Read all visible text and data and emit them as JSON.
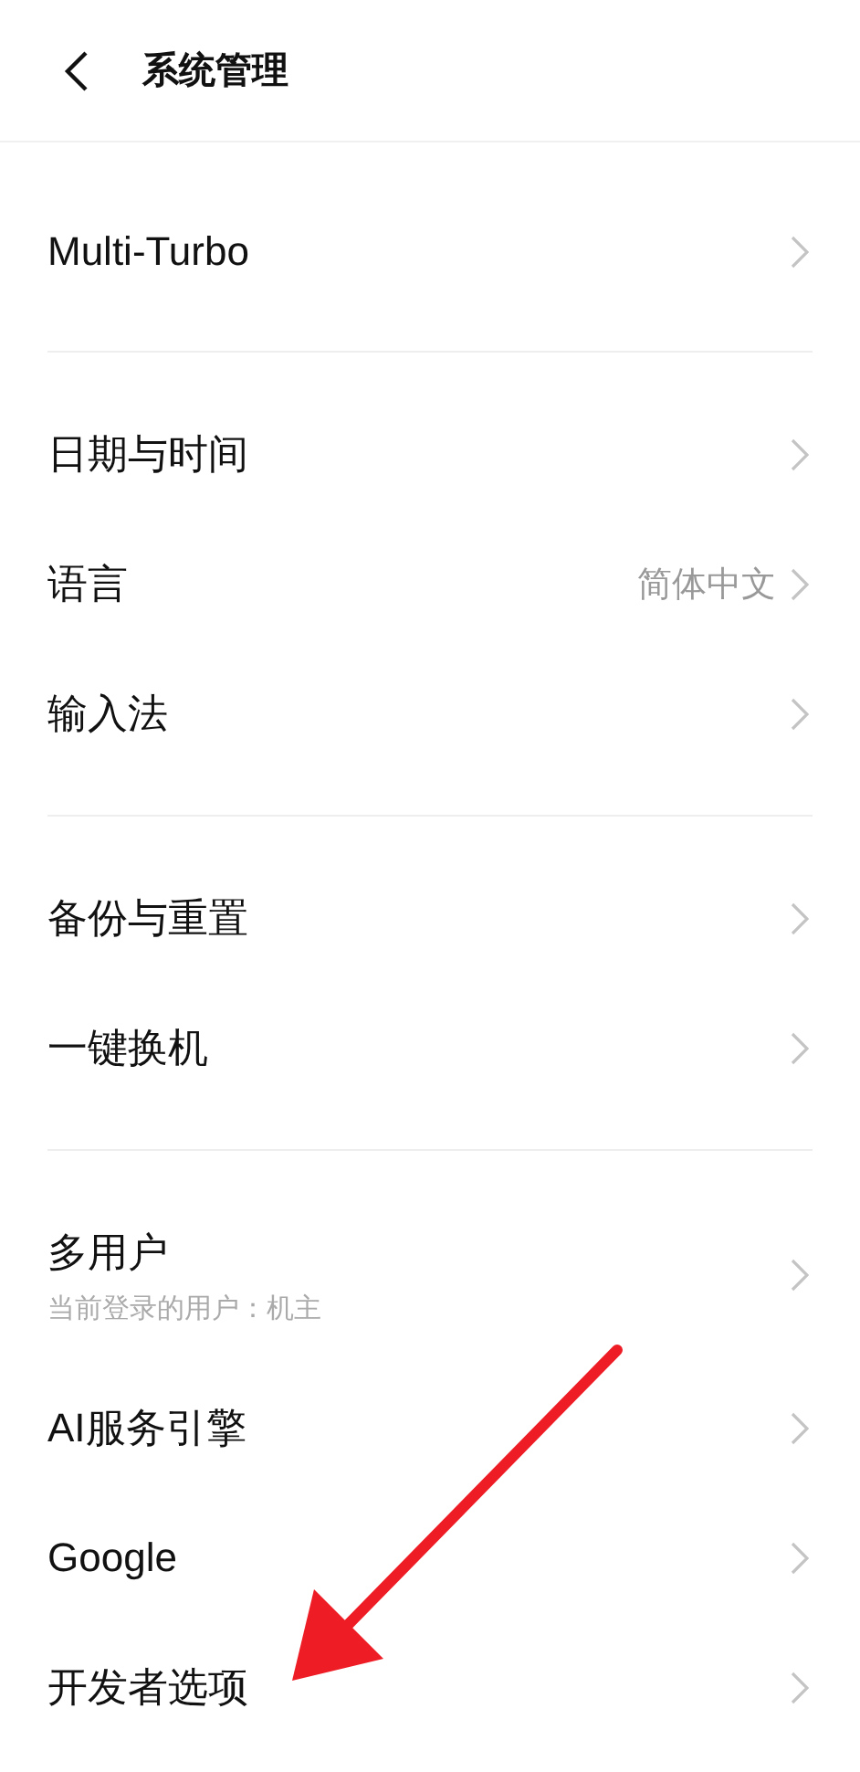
{
  "header": {
    "title": "系统管理"
  },
  "sections": [
    {
      "items": [
        {
          "label": "Multi-Turbo"
        }
      ]
    },
    {
      "items": [
        {
          "label": "日期与时间"
        },
        {
          "label": "语言",
          "value": "简体中文"
        },
        {
          "label": "输入法"
        }
      ]
    },
    {
      "items": [
        {
          "label": "备份与重置"
        },
        {
          "label": "一键换机"
        }
      ]
    },
    {
      "items": [
        {
          "label": "多用户",
          "subtitle": "当前登录的用户：机主"
        },
        {
          "label": "AI服务引擎"
        },
        {
          "label": "Google"
        },
        {
          "label": "开发者选项"
        }
      ]
    }
  ]
}
